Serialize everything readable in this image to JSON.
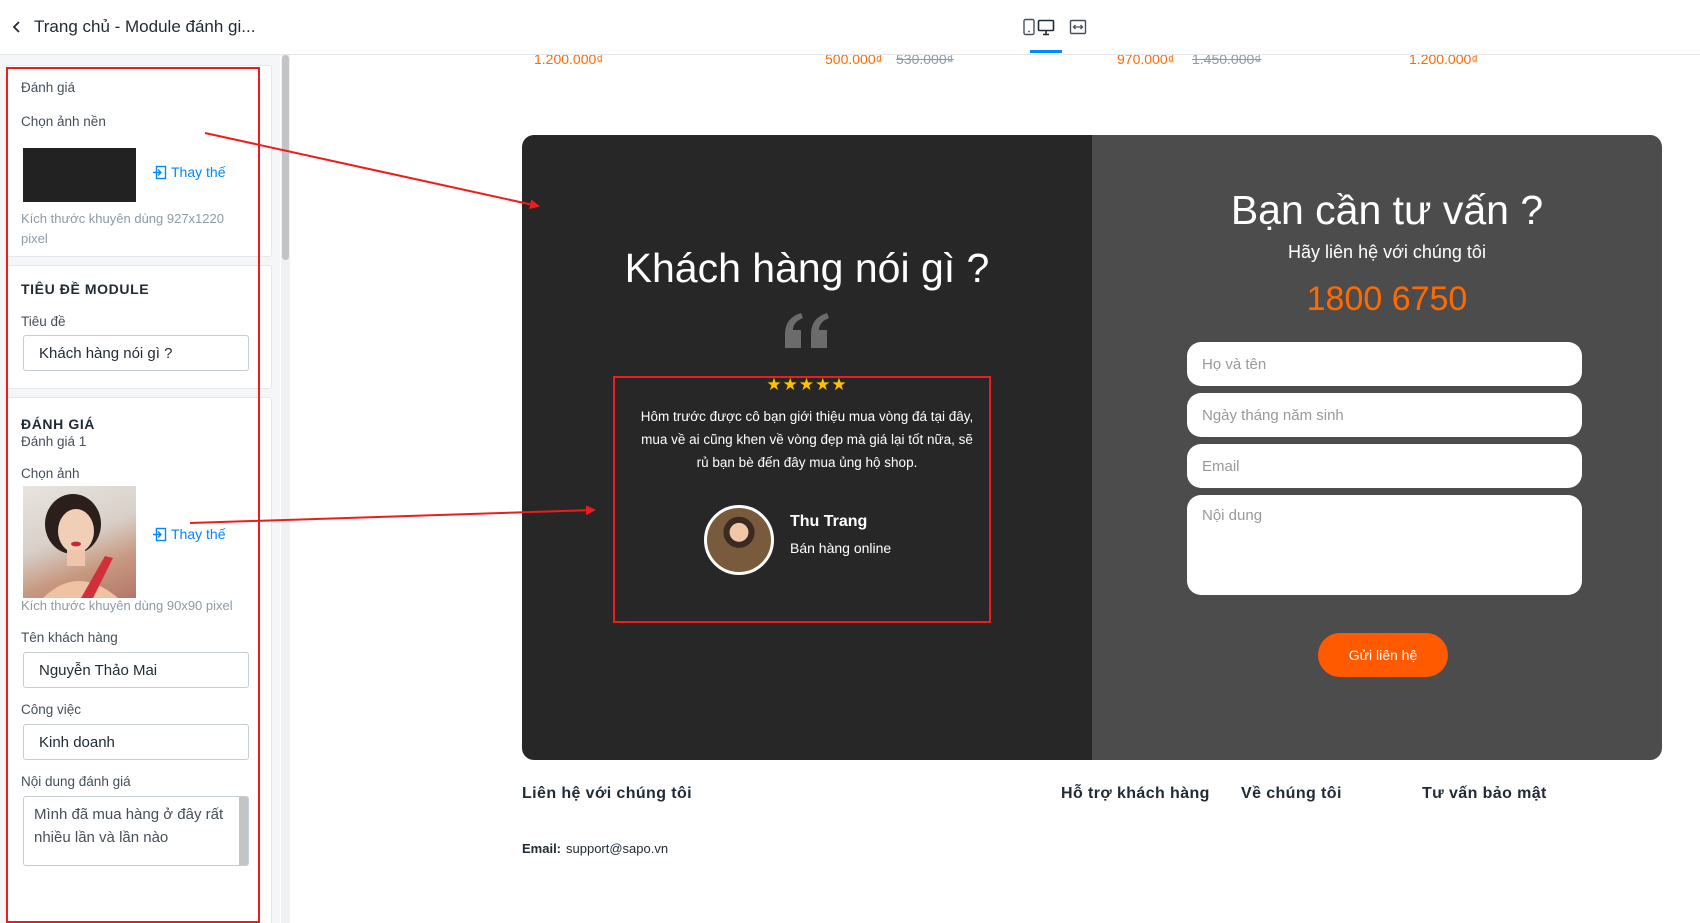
{
  "header": {
    "title": "Trang chủ - Module đánh gi..."
  },
  "panel": {
    "section1": {
      "label": "Đánh giá",
      "bg_label": "Chọn ảnh nền",
      "replace": "Thay thế",
      "hint": "Kích thước khuyên dùng 927x1220 pixel"
    },
    "section2": {
      "title": "TIÊU ĐỀ MODULE",
      "field_label": "Tiêu đề",
      "field_value": "Khách hàng nói gì ?"
    },
    "section3": {
      "title": "ĐÁNH GIÁ",
      "subtitle": "Đánh giá 1",
      "image_label": "Chọn ảnh",
      "replace": "Thay thế",
      "hint": "Kích thước khuyên dùng 90x90 pixel",
      "name_label": "Tên khách hàng",
      "name_value": "Nguyễn Thảo Mai",
      "job_label": "Công việc",
      "job_value": "Kinh doanh",
      "content_label": "Nội dung đánh giá",
      "content_value": "Mình đã mua hàng ở đây rất nhiều lần và lần nào"
    }
  },
  "prices": {
    "p1": "1.200.000₫",
    "p2": "500.000₫",
    "p2_old": "530.000₫",
    "p3": "970.000₫",
    "p3_old": "1.450.000₫",
    "p4": "1.200.000₫"
  },
  "testimonial": {
    "title": "Khách hàng nói gì ?",
    "stars": "★★★★★",
    "text": "Hôm trước được cô bạn giới thiệu mua vòng đá tại đây, mua về ai cũng khen về vòng đẹp mà giá lại tốt nữa, sẽ rủ bạn bè đến đây mua ủng hộ shop.",
    "name": "Thu Trang",
    "job": "Bán hàng online"
  },
  "contact": {
    "title": "Bạn cần tư vấn ?",
    "subtitle": "Hãy liên hệ với chúng tôi",
    "phone": "1800 6750",
    "name_placeholder": "Họ và tên",
    "dob_placeholder": "Ngày tháng năm sinh",
    "email_placeholder": "Email",
    "content_placeholder": "Nội dung",
    "submit": "Gửi liên hệ"
  },
  "footer": {
    "contact": "Liên hệ với chúng tôi",
    "support": "Hỗ trợ khách hàng",
    "about": "Về chúng tôi",
    "privacy": "Tư vấn bảo mật",
    "email_label": "Email:",
    "email_value": "support@sapo.vn"
  },
  "colors": {
    "accent": "#0088ff",
    "orange": "#ff6a00",
    "annotation": "#ee1c1c"
  }
}
